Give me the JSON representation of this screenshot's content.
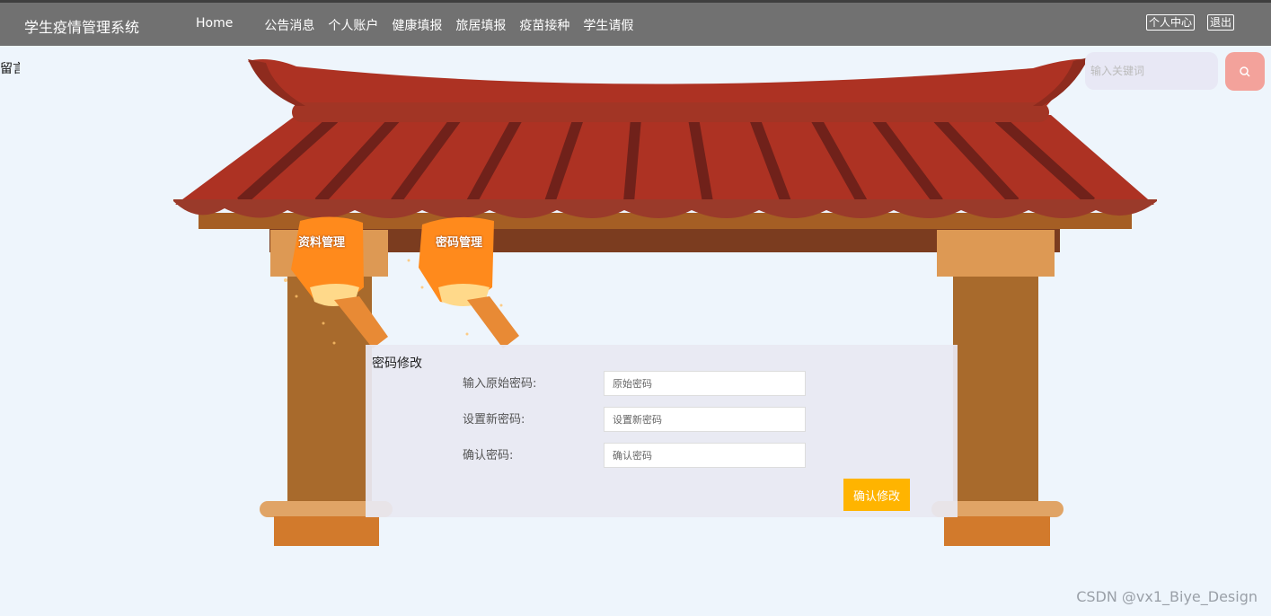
{
  "header": {
    "brand": "学生疫情管理系统",
    "nav": [
      "Home",
      "公告消息",
      "个人账户",
      "健康填报",
      "旅居填报",
      "疫苗接种",
      "学生请假"
    ],
    "personal_center": "个人中心",
    "logout": "退出"
  },
  "breadcrumb": "留言",
  "search": {
    "placeholder": "输入关键词",
    "icon": "search-icon"
  },
  "lanterns": [
    "资料管理",
    "密码管理"
  ],
  "panel": {
    "title": "密码修改",
    "fields": [
      {
        "label": "输入原始密码:",
        "placeholder": "原始密码"
      },
      {
        "label": "设置新密码:",
        "placeholder": "设置新密码"
      },
      {
        "label": "确认密码:",
        "placeholder": "确认密码"
      }
    ],
    "confirm": "确认修改"
  },
  "watermark": "CSDN @vx1_Biye_Design",
  "colors": {
    "topbar": "#717171",
    "roof": "#ad3223",
    "pillar": "#a86a2c",
    "button": "#ffb400",
    "search_button": "#f3a29b"
  }
}
